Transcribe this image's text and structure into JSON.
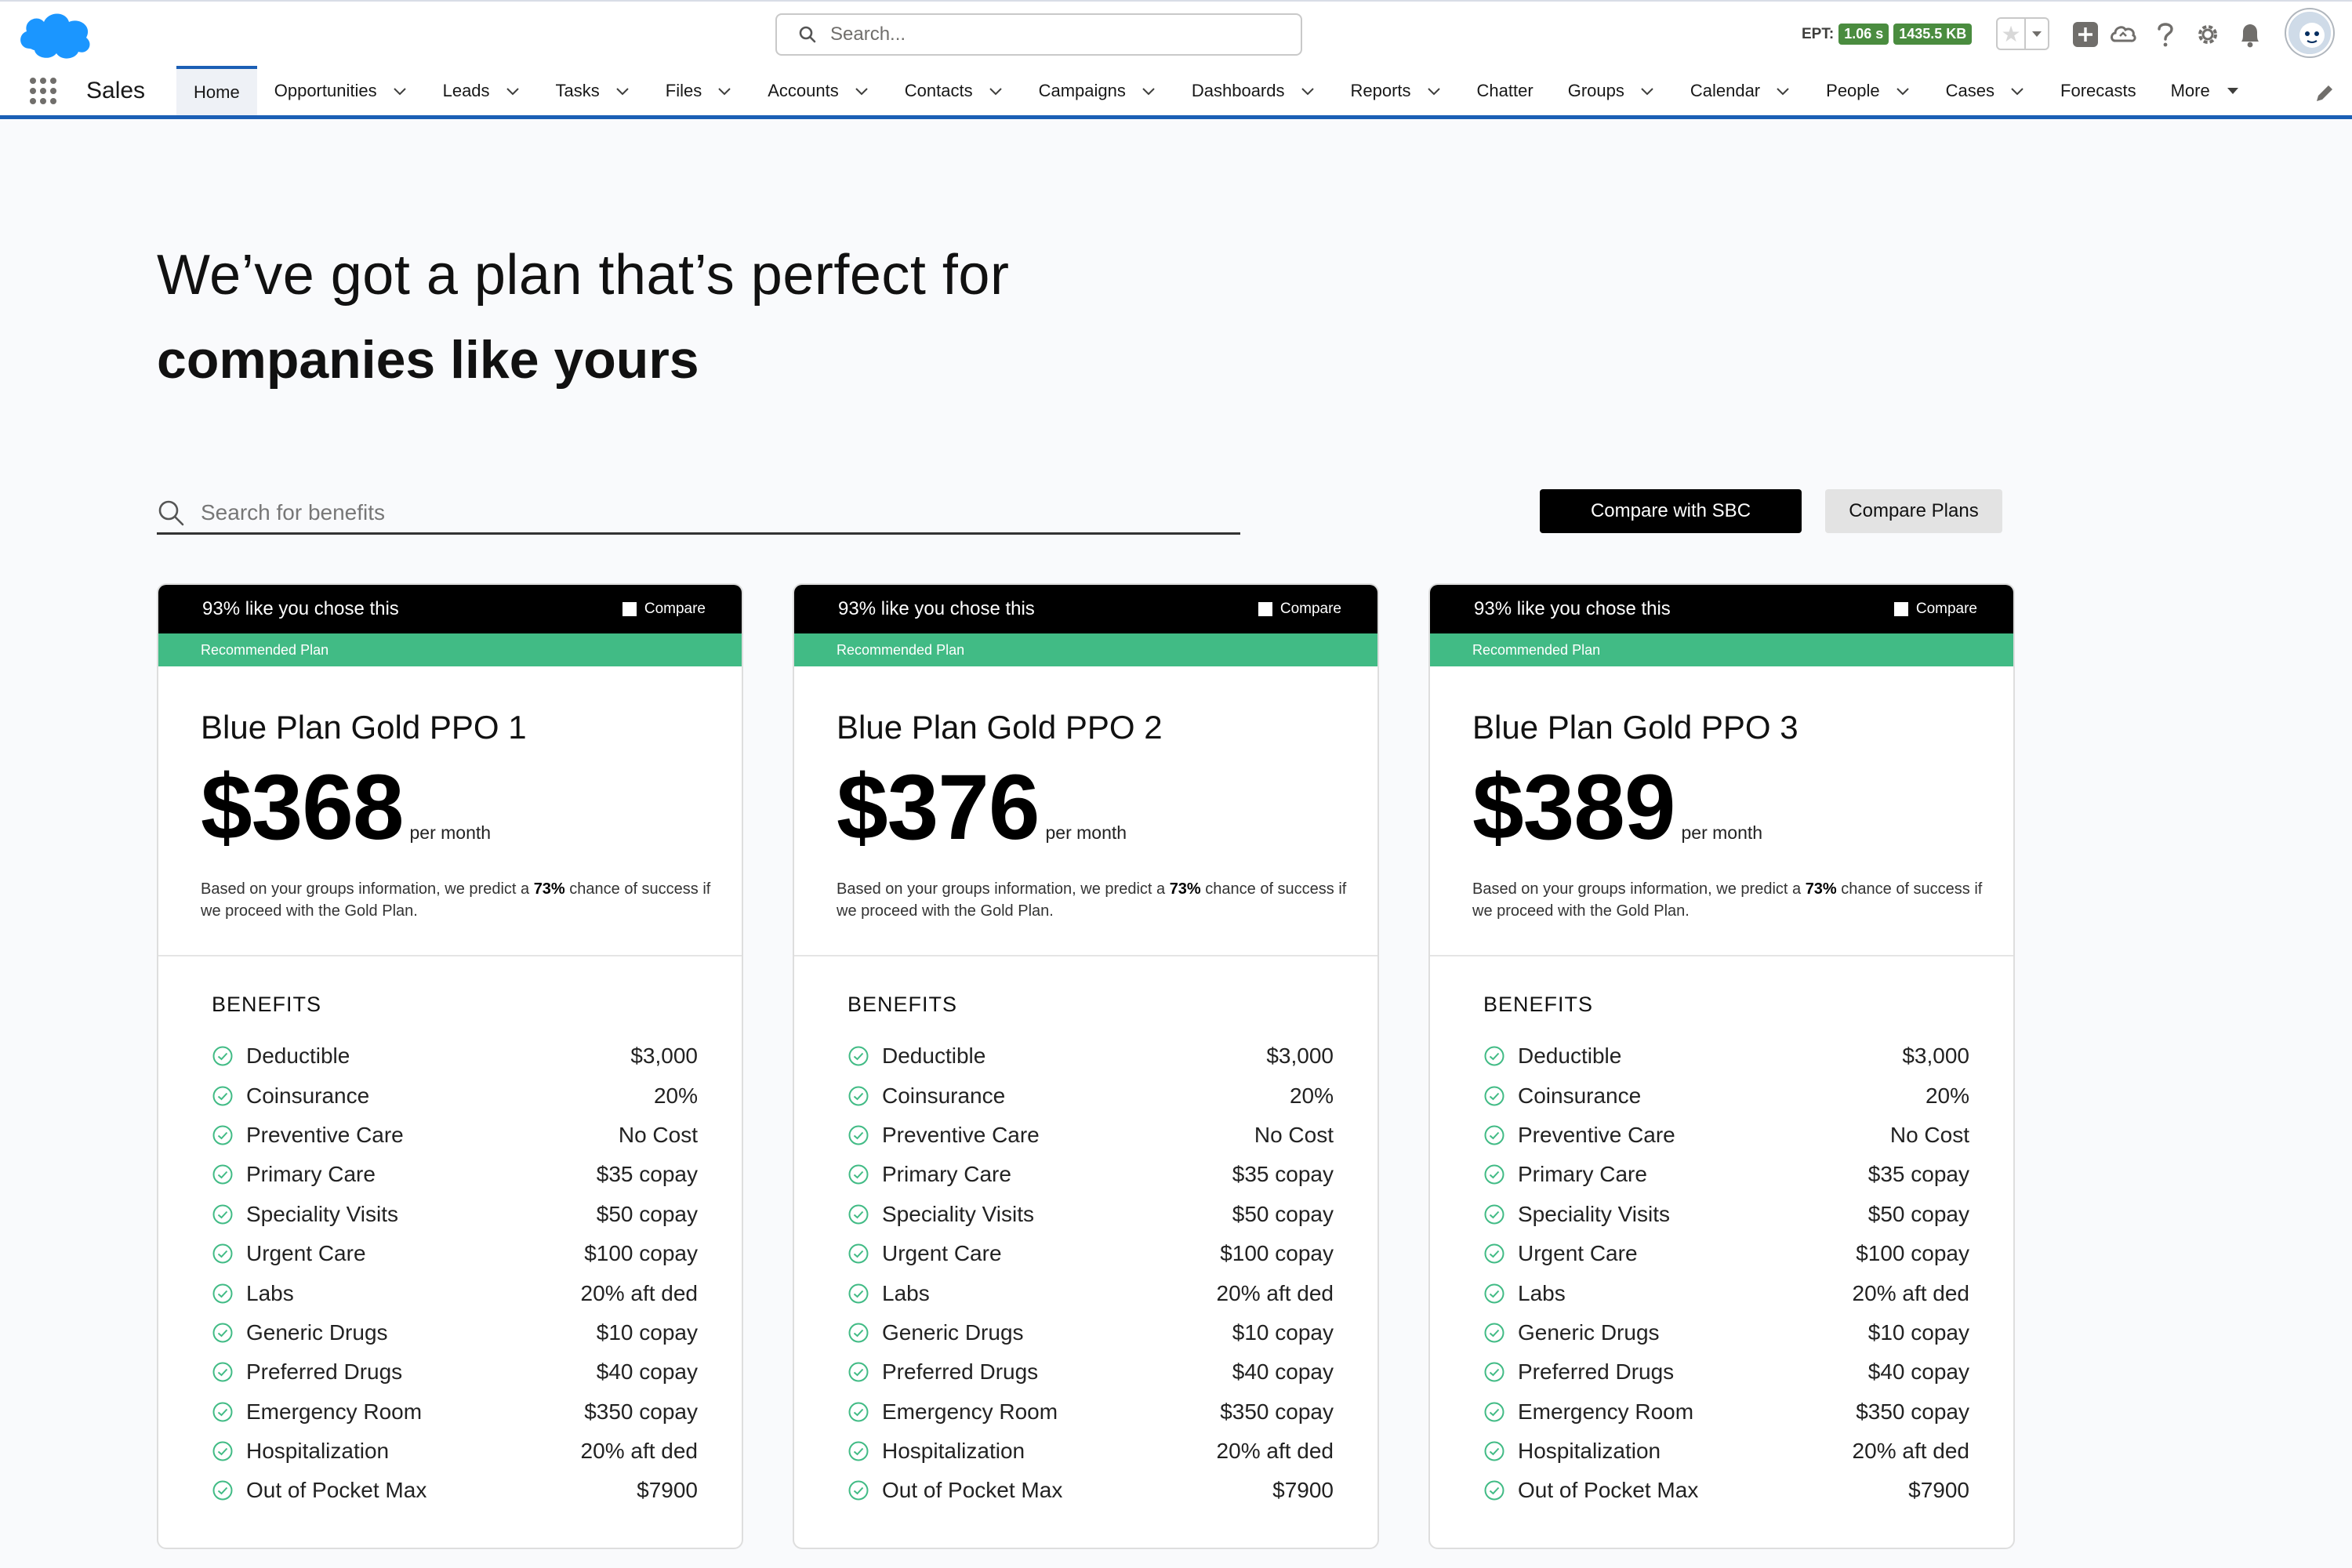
{
  "header": {
    "search_placeholder": "Search...",
    "ept_label": "EPT:",
    "ept_time": "1.06 s",
    "ept_size": "1435.5 KB",
    "brand_color": "#1b96ff"
  },
  "nav": {
    "app_name": "Sales",
    "items": [
      {
        "label": "Home",
        "active": true,
        "dropdown": false
      },
      {
        "label": "Opportunities",
        "dropdown": true
      },
      {
        "label": "Leads",
        "dropdown": true
      },
      {
        "label": "Tasks",
        "dropdown": true
      },
      {
        "label": "Files",
        "dropdown": true
      },
      {
        "label": "Accounts",
        "dropdown": true
      },
      {
        "label": "Contacts",
        "dropdown": true
      },
      {
        "label": "Campaigns",
        "dropdown": true
      },
      {
        "label": "Dashboards",
        "dropdown": true
      },
      {
        "label": "Reports",
        "dropdown": true
      },
      {
        "label": "Chatter",
        "dropdown": false
      },
      {
        "label": "Groups",
        "dropdown": true
      },
      {
        "label": "Calendar",
        "dropdown": true
      },
      {
        "label": "People",
        "dropdown": true
      },
      {
        "label": "Cases",
        "dropdown": true
      },
      {
        "label": "Forecasts",
        "dropdown": false
      },
      {
        "label": "More",
        "dropdown": true
      }
    ]
  },
  "hero": {
    "line1": "We’ve got a plan that’s perfect for",
    "line2": "companies like yours"
  },
  "benefit_search": {
    "placeholder": "Search for benefits"
  },
  "buttons": {
    "compare_sbc": "Compare with SBC",
    "compare_plans": "Compare Plans"
  },
  "plans": [
    {
      "like_text": "93% like you chose this",
      "compare_label": "Compare",
      "recommended": "Recommended Plan",
      "name": "Blue Plan Gold PPO 1",
      "price": "$368",
      "per": "per month",
      "blurb_pre": "Based on your groups information, we predict a ",
      "blurb_pct": "73%",
      "blurb_post": " chance of success if we proceed with the Gold Plan.",
      "benefits_title": "BENEFITS"
    },
    {
      "like_text": "93% like you chose this",
      "compare_label": "Compare",
      "recommended": "Recommended Plan",
      "name": "Blue Plan Gold PPO 2",
      "price": "$376",
      "per": "per month",
      "blurb_pre": "Based on your groups information, we predict a ",
      "blurb_pct": "73%",
      "blurb_post": " chance of success if we proceed with the Gold Plan.",
      "benefits_title": "BENEFITS"
    },
    {
      "like_text": "93% like you chose this",
      "compare_label": "Compare",
      "recommended": "Recommended Plan",
      "name": "Blue Plan Gold PPO 3",
      "price": "$389",
      "per": "per month",
      "blurb_pre": "Based on your groups information, we predict a ",
      "blurb_pct": "73%",
      "blurb_post": " chance of success if we proceed with the Gold Plan.",
      "benefits_title": "BENEFITS"
    }
  ],
  "benefits": [
    {
      "label": "Deductible",
      "value": "$3,000"
    },
    {
      "label": "Coinsurance",
      "value": "20%"
    },
    {
      "label": "Preventive Care",
      "value": "No Cost"
    },
    {
      "label": "Primary Care",
      "value": "$35 copay"
    },
    {
      "label": "Speciality Visits",
      "value": "$50 copay"
    },
    {
      "label": "Urgent Care",
      "value": "$100 copay"
    },
    {
      "label": "Labs",
      "value": "20% aft ded"
    },
    {
      "label": "Generic Drugs",
      "value": "$10 copay"
    },
    {
      "label": "Preferred Drugs",
      "value": "$40 copay"
    },
    {
      "label": "Emergency Room",
      "value": "$350 copay"
    },
    {
      "label": "Hospitalization",
      "value": "20% aft ded"
    },
    {
      "label": "Out of Pocket Max",
      "value": "$7900"
    }
  ]
}
